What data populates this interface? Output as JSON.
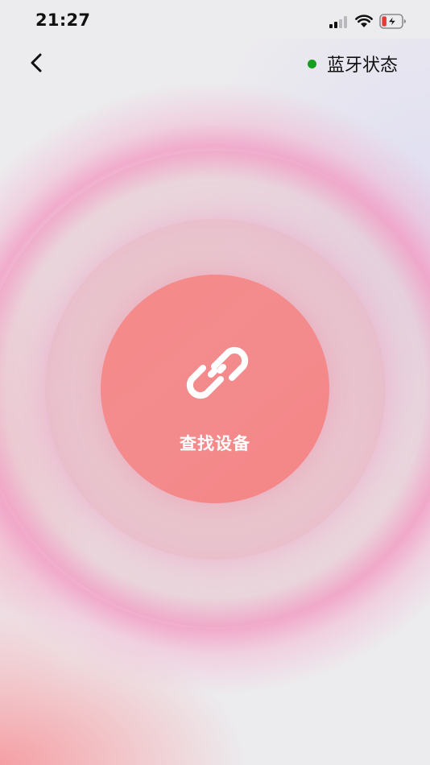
{
  "status_bar": {
    "time": "21:27",
    "icons": [
      "signal-icon",
      "wifi-icon",
      "battery-charging-icon"
    ]
  },
  "nav": {
    "back_icon": "chevron-left-icon",
    "bluetooth_status_label": "蓝牙状态",
    "bluetooth_dot_color": "#14a01e"
  },
  "main": {
    "find_device_icon": "link-icon",
    "find_device_label": "查找设备",
    "core_color": "#f58a88"
  },
  "colors": {
    "background": "#ecebee",
    "glow_pink": "#f2a0c6",
    "battery_low": "#e53935"
  }
}
